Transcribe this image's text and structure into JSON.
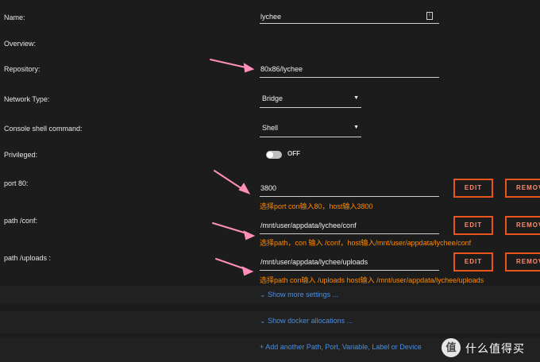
{
  "labels": {
    "name": "Name:",
    "overview": "Overview:",
    "repository": "Repository:",
    "network": "Network Type:",
    "console": "Console shell command:",
    "privileged": "Privileged:",
    "port80": "port 80:",
    "conf": "path /conf:",
    "uploads": "path /uploads :"
  },
  "fields": {
    "name": "lychee",
    "repository": "80x86/lychee",
    "network": "Bridge",
    "console": "Shell",
    "port80": "3800",
    "conf": "/mnt/user/appdata/lychee/conf",
    "uploads": "/mnt/user/appdata/lychee/uploads"
  },
  "privileged_toggle": "OFF",
  "notes": {
    "port80": "选择port con输入80，host输入3800",
    "conf": "选择path，con 输入 /conf，host输入/mnt/user/appdata/lychee/conf",
    "uploads": "选择path con输入 /uploads host输入 /mnt/user/appdata/lychee/uploads"
  },
  "buttons": {
    "edit": "EDIT",
    "remove": "REMOVE"
  },
  "links": {
    "more_settings": "Show more settings ...",
    "docker_allocations": "Show docker allocations ...",
    "add_another": "Add another Path, Port, Variable, Label or Device"
  },
  "icons": {
    "select_caret": "caret-down",
    "more_settings": "chevron-down",
    "docker_allocations": "chevron-down",
    "add_another": "plus"
  },
  "watermark": {
    "logo": "值",
    "text": "什么值得买"
  },
  "colors": {
    "accent": "#e8541c",
    "note": "#ff8a00",
    "link": "#4a8fe0",
    "arrow": "#ff8fb8"
  }
}
